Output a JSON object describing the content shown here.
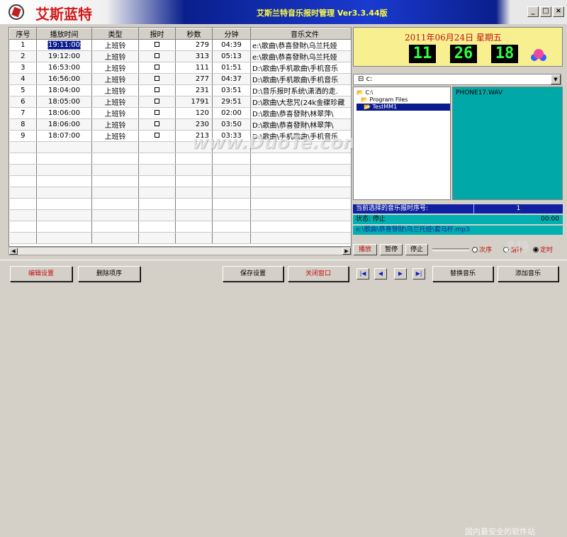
{
  "window": {
    "brand": "艾斯蓝特",
    "title": "艾斯兰特音乐报时管理 Ver3.3.44版",
    "min_label": "_",
    "max_label": "□",
    "close_label": "×"
  },
  "table": {
    "headers": [
      "序号",
      "播放时间",
      "类型",
      "报时",
      "秒数",
      "分钟",
      "音乐文件"
    ],
    "rows": [
      {
        "no": "1",
        "time": "19:11:00",
        "type": "上班铃",
        "sec": "279",
        "min": "04:39",
        "file": "e:\\歌曲\\恭喜發財\\乌兰托娅"
      },
      {
        "no": "2",
        "time": "19:12:00",
        "type": "上班铃",
        "sec": "313",
        "min": "05:13",
        "file": "e:\\歌曲\\恭喜發財\\乌兰托娅"
      },
      {
        "no": "3",
        "time": "16:53:00",
        "type": "上班铃",
        "sec": "111",
        "min": "01:51",
        "file": "D:\\歌曲\\手机歌曲\\手机音乐"
      },
      {
        "no": "4",
        "time": "16:56:00",
        "type": "上班铃",
        "sec": "277",
        "min": "04:37",
        "file": "D:\\歌曲\\手机歌曲\\手机音乐"
      },
      {
        "no": "5",
        "time": "18:04:00",
        "type": "上班铃",
        "sec": "231",
        "min": "03:51",
        "file": "D:\\音乐报时系统\\潇洒的走."
      },
      {
        "no": "6",
        "time": "18:05:00",
        "type": "上班铃",
        "sec": "1791",
        "min": "29:51",
        "file": "D:\\歌曲\\大悲咒(24k金碟珍藏"
      },
      {
        "no": "7",
        "time": "18:06:00",
        "type": "上班铃",
        "sec": "120",
        "min": "02:00",
        "file": "D:\\歌曲\\恭喜發財\\林翠萍\\"
      },
      {
        "no": "8",
        "time": "18:06:00",
        "type": "上班铃",
        "sec": "230",
        "min": "03:50",
        "file": "D:\\歌曲\\恭喜發財\\林翠萍\\"
      },
      {
        "no": "9",
        "time": "18:07:00",
        "type": "上班铃",
        "sec": "213",
        "min": "03:33",
        "file": "D:\\歌曲\\手机歌曲\\手机音乐"
      }
    ]
  },
  "clock": {
    "date": "2011年06月24日  星期五",
    "hh": "11",
    "mm": "26",
    "ss": "18"
  },
  "drive": {
    "value": "c:"
  },
  "dirs": [
    "C:\\",
    "Program Files",
    "TestMM1"
  ],
  "files": [
    "PHONE17.WAV"
  ],
  "status": {
    "selected_label": "当前选择的音乐报时序号:",
    "selected_value": "1",
    "state_label": "状态: 停止",
    "time_value": "00:00",
    "path": "e:\\歌曲\\恭喜發財\\乌兰托娅\\套马杆.mp3"
  },
  "controls": {
    "play": "播放",
    "pause": "暂停",
    "stop": "停止",
    "order": "次序",
    "loop": "循环",
    "timed": "定时"
  },
  "bottom": {
    "edit": "编辑设置",
    "delete": "删除项序",
    "save": "保存设置",
    "close": "关闭窗口",
    "first": "|◀",
    "prev": "◀",
    "next": "▶",
    "last": "▶|",
    "replace": "替换音乐",
    "add": "添加音乐"
  },
  "watermarks": {
    "duote": "www.DuoTe.com",
    "brand2": "多特",
    "brand3": "国内最安全的软件站"
  }
}
